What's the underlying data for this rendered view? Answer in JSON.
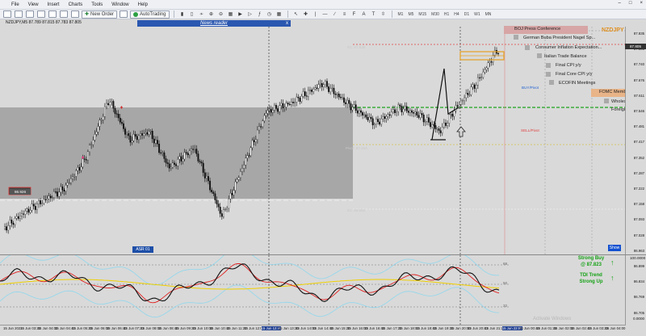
{
  "menu": [
    "File",
    "View",
    "Insert",
    "Charts",
    "Tools",
    "Window",
    "Help"
  ],
  "toolbar": {
    "new_order": "New Order",
    "autotrading": "AutoTrading",
    "timeframes": [
      "M1",
      "M5",
      "M15",
      "M30",
      "H1",
      "H4",
      "D1",
      "W1",
      "MN"
    ]
  },
  "chart": {
    "symbol_label": "NZDJPY,M5  87.789 87.815 87.783 87.805",
    "news_reader": "News reader",
    "close_glyph": "x",
    "symbol_badge": "NZDJPY",
    "asr_button": "ASR 01",
    "show_button": "Show",
    "buy_pivot": "BUY/Pivot",
    "sell_pivot": "SELL/Pivot",
    "pivot_label": "Pivot: 87.254",
    "r1_label": "R1: 87.648",
    "s1_label": "S1: 86.860",
    "box_label": "86.926"
  },
  "events": [
    "BOJ Press Conference",
    "German Buba President Nagel Sp...",
    "Consumer Inflation Expectation...",
    "Italian Trade Balance",
    "Final CPI y/y",
    "Final Core CPI y/y",
    "ECOFIN Meetings",
    "FOMC Member ...",
    "Wholesale ...",
    "Foreign ..."
  ],
  "price_axis": [
    "87.835",
    "87.805",
    "87.740",
    "87.676",
    "87.611",
    "87.546",
    "87.481",
    "87.417",
    "87.352",
    "87.287",
    "87.222",
    "87.158",
    "87.093",
    "87.028",
    "86.963",
    "86.899",
    "86.834",
    "86.769",
    "86.705"
  ],
  "current_price": "87.805",
  "tdi": {
    "label": "TDI Alerts • 74.7474 62.8032 55.8590 67.3646 67.0529 0.0000",
    "levels": [
      "68",
      "50",
      "32"
    ],
    "axis": [
      "100.0000",
      "0.0000"
    ]
  },
  "signals": {
    "strong_buy": "Strong Buy",
    "buy_price": "@ 87.823",
    "trend": "TDI Trend",
    "trend_state": "Strong Up"
  },
  "time_axis": [
    "15 Jun 2023",
    "15 Jun 03:20",
    "15 Jun 04:00",
    "15 Jun 04:40",
    "15 Jun 05:20",
    "15 Jun 06:00",
    "15 Jun 06:40",
    "15 Jun 07:20",
    "15 Jun 08:00",
    "15 Jun 08:40",
    "15 Jun 09:20",
    "15 Jun 10:00",
    "15 Jun 10:40",
    "15 Jun 11:20",
    "15 Jun 12:00",
    "15 Jun 12:40",
    "15 Jun 13:20",
    "15 Jun 14:00",
    "15 Jun 14:40",
    "15 Jun 15:20",
    "15 Jun 16:00",
    "15 Jun 16:40",
    "15 Jun 17:20",
    "15 Jun 18:00",
    "15 Jun 18:40",
    "15 Jun 19:20",
    "15 Jun 20:00",
    "15 Jun 20:40",
    "15 Jun 21:20",
    "15 Jun 22:00",
    "16 Jun 00:40",
    "16 Jun 01:20",
    "16 Jun 02:00",
    "16 Jun 02:40",
    "16 Jun 03:20",
    "16 Jun 04:00"
  ],
  "watermark": "Activate Windows",
  "colors": {
    "bull": "#ffffff",
    "bear": "#111111",
    "pivot": "#d4c04a",
    "r1": "#e04040",
    "green_line": "#1fa51f",
    "buy": "#1f5fd0",
    "sell": "#e04040",
    "tdi_green": "#111111",
    "tdi_red": "#e02020",
    "tdi_yellow": "#f0d000",
    "tdi_band": "#8fd8ee",
    "signal": "#14a114"
  }
}
